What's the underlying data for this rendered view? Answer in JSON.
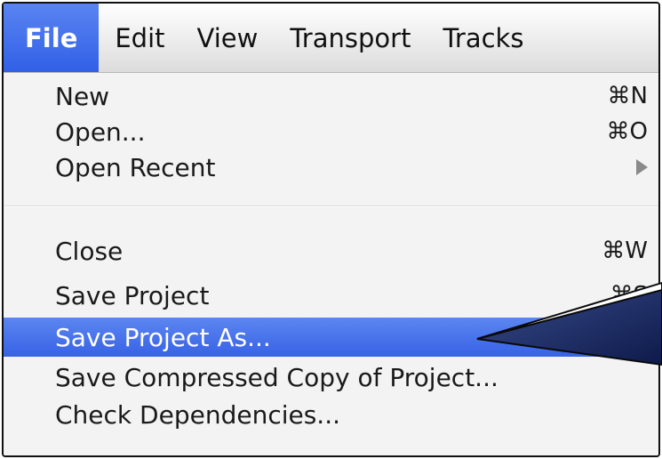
{
  "menubar": {
    "items": [
      {
        "label": "File",
        "active": true
      },
      {
        "label": "Edit"
      },
      {
        "label": "View"
      },
      {
        "label": "Transport"
      },
      {
        "label": "Tracks"
      }
    ]
  },
  "file_menu": {
    "new": {
      "label": "New",
      "shortcut": "⌘N"
    },
    "open": {
      "label": "Open...",
      "shortcut": "⌘O"
    },
    "open_recent": {
      "label": "Open Recent"
    },
    "close": {
      "label": "Close",
      "shortcut": "⌘W"
    },
    "save_project": {
      "label": "Save Project",
      "shortcut": "⌘S"
    },
    "save_project_as": {
      "label": "Save Project As..."
    },
    "save_compressed": {
      "label": "Save Compressed Copy of Project..."
    },
    "check_dependencies": {
      "label": "Check Dependencies..."
    }
  },
  "colors": {
    "highlight": "#3d68e8",
    "callout_fill": "#1e2f6e"
  }
}
